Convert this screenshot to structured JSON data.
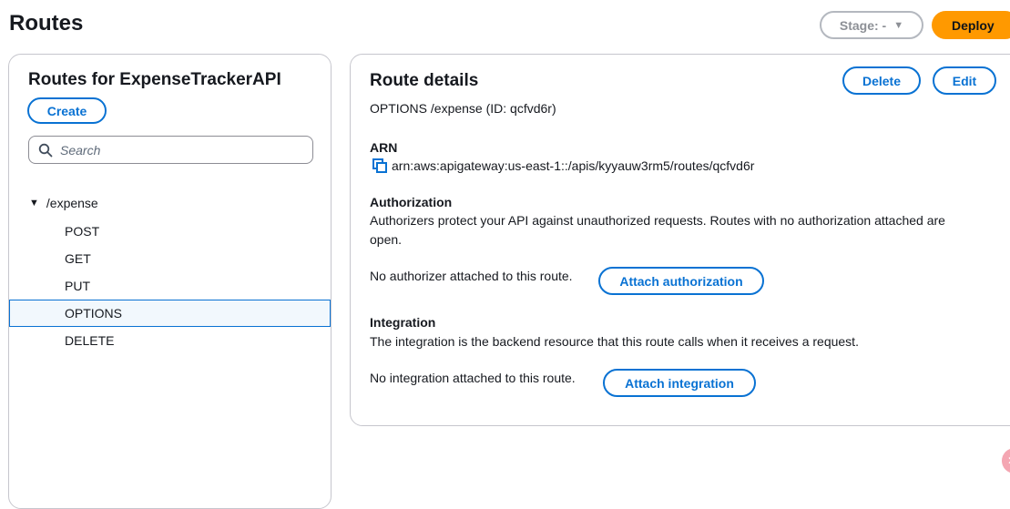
{
  "header": {
    "title": "Routes",
    "stage_label": "Stage: -",
    "deploy_label": "Deploy"
  },
  "routes_panel": {
    "title": "Routes for ExpenseTrackerAPI",
    "create_label": "Create",
    "search_placeholder": "Search",
    "tree": {
      "path": "/expense",
      "methods": [
        "POST",
        "GET",
        "PUT",
        "OPTIONS",
        "DELETE"
      ],
      "selected": "OPTIONS"
    }
  },
  "details_panel": {
    "title": "Route details",
    "delete_label": "Delete",
    "edit_label": "Edit",
    "subtitle": "OPTIONS /expense (ID: qcfvd6r)",
    "arn_label": "ARN",
    "arn_value": "arn:aws:apigateway:us-east-1::/apis/kyyauw3rm5/routes/qcfvd6r",
    "authorization": {
      "label": "Authorization",
      "description": "Authorizers protect your API against unauthorized requests. Routes with no authorization attached are open.",
      "status": "No authorizer attached to this route.",
      "button": "Attach authorization"
    },
    "integration": {
      "label": "Integration",
      "description": "The integration is the backend resource that this route calls when it receives a request.",
      "status": "No integration attached to this route.",
      "button": "Attach integration"
    }
  },
  "icons": {
    "search": "search-icon",
    "caret": "caret-down-icon",
    "copy": "copy-icon"
  },
  "colors": {
    "accent": "#0972d3",
    "deploy": "#ff9900",
    "selected_bg": "#f2f8fd"
  }
}
